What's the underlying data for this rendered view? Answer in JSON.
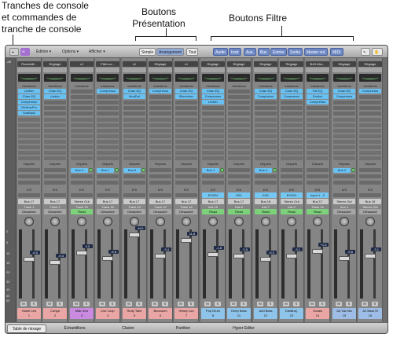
{
  "annotations": {
    "strips": "Tranches de console\net commandes de\ntranche de console",
    "view_buttons": "Boutons\nPrésentation",
    "filter_buttons": "Boutons Filtre"
  },
  "toolbar": {
    "edit": "Édition",
    "options": "Options",
    "view": "Afficher",
    "view_buttons": [
      "Simple",
      "Arrangement",
      "Tout"
    ],
    "view_selected": "Arrangement",
    "filter_buttons": [
      "Audio",
      "Instr",
      "Aux.",
      "Bus",
      "Entrée",
      "Sortie",
      "Master vol.",
      "MIDI"
    ]
  },
  "labels": {
    "settings": "Réglage",
    "inserts": "Insertions",
    "sends": "Départs",
    "io": "E/S",
    "off": "Désactivé",
    "read": "Read",
    "sidechain": "Side Chain"
  },
  "scale_marks": [
    "-dB",
    "0",
    "6",
    "10",
    "15",
    "20",
    "30",
    "40",
    "50",
    "60"
  ],
  "strips": [
    {
      "setting": "Rockabill...",
      "inserts": [
        "Limiter",
        "Chan EQ",
        "Compresso",
        "GtrAmpPro",
        "SubBass"
      ],
      "send": "",
      "input": "",
      "output": "Bus 17",
      "group": "Track 1",
      "auto": "Désactivé",
      "db": "-6.0",
      "name": "Noise Lea",
      "num": "1",
      "color": "#e9a6a4"
    },
    {
      "setting": "Réglage",
      "inserts": [
        "Chan EQ",
        "Limiter"
      ],
      "send": "",
      "input": "",
      "output": "Bus 17",
      "group": "Track 2",
      "auto": "Désactivé",
      "db": "-9.4",
      "name": "Conga",
      "num": "2",
      "color": "#e9a6a4"
    },
    {
      "setting": "v1",
      "inserts": [],
      "send": "Bus 4",
      "input": "",
      "output": "Stereo Out",
      "group": "Track 15",
      "auto": "Read",
      "db": "0.0",
      "name": "Main Dru",
      "num": "3",
      "color": "#c98ae0"
    },
    {
      "setting": "Filter.co...",
      "inserts": [
        "Compresso"
      ],
      "send": "Bus 1",
      "input": "",
      "output": "Bus 17",
      "group": "Track 18",
      "auto": "Désactivé",
      "db": "-5.6",
      "name": "Live Loop",
      "num": "4",
      "color": "#e9a6a4"
    },
    {
      "setting": "v1",
      "inserts": [
        "Chan EQ",
        "ModDel"
      ],
      "send": "Bus 5",
      "input": "",
      "output": "Bus 17",
      "group": "Track 23",
      "auto": "Désactivé",
      "db": "44.0",
      "name": "Rudy Tabe",
      "num": "5",
      "color": "#e9a6a4"
    },
    {
      "setting": "Réglage",
      "inserts": [
        "Compresso"
      ],
      "send": "",
      "input": "",
      "output": "Bus 17",
      "group": "Track 22",
      "auto": "Désactivé",
      "db": "-3.4",
      "name": "Booooom",
      "num": "6",
      "color": "#e9a6a4"
    },
    {
      "setting": "v1",
      "inserts": [
        "Chan EQ",
        "Bitcrusher"
      ],
      "send": "",
      "input": "",
      "output": "Bus 17",
      "group": "Track 16",
      "auto": "Désactivé",
      "db": "11.8",
      "name": "Heavy Loo",
      "num": "7",
      "color": "#e9a6a4"
    },
    {
      "setting": "Réglage",
      "inserts": [
        "Chan EQ",
        "Compresso",
        "Limiter"
      ],
      "send": "Bus 1",
      "input": "EXS24",
      "output": "Bus 17",
      "group": "Inst 15",
      "auto": "Read",
      "db": "-1.8",
      "name": "Pop Drum",
      "num": "8",
      "color": "#8fc4ea"
    },
    {
      "setting": "Réglage",
      "inserts": [],
      "send": "",
      "input": "ES1",
      "output": "Bus 17",
      "group": "Inst 6",
      "auto": "Read",
      "db": "-3.5",
      "name": "Deep Bass",
      "num": "11",
      "color": "#8fc4ea"
    },
    {
      "setting": "Réglage",
      "inserts": [
        "Chan EQ",
        "Compresso"
      ],
      "send": "Bus 4",
      "input": "ES2",
      "output": "Bus 18",
      "group": "Inst 7",
      "auto": "Read",
      "db": "-6.0",
      "name": "Add Bass",
      "num": "12",
      "color": "#8fc4ea"
    },
    {
      "setting": "Réglage",
      "inserts": [
        "Chan EQ",
        "Compresso"
      ],
      "send": "",
      "input": "EXS24",
      "output": "Stereo Out",
      "group": "Inst 2",
      "auto": "Read",
      "db": "-3.1",
      "name": "Distillus(.",
      "num": "13",
      "color": "#8fc4ea"
    },
    {
      "setting": "B4S-Mor...",
      "inserts": [
        "Fat EQ",
        "Exciter",
        "Compresso"
      ],
      "send": "",
      "input": "Input 1 - 2",
      "output": "Bus 17",
      "group": "Track 15",
      "auto": "Read",
      "db": "+1.5",
      "name": "Vocals",
      "num": "14",
      "color": "#e9a6a4"
    },
    {
      "setting": "Réglage",
      "inserts": [
        "Chan EQ",
        "Compresso"
      ],
      "send": "Bus 2",
      "input": "",
      "output": "Stereo Out",
      "group": "Aux 4",
      "auto": "Désactivé",
      "db": "-5.6",
      "name": "A4 Vac Ma",
      "num": "15",
      "color": "#9dbde6"
    },
    {
      "setting": "Réglage",
      "inserts": [
        "Compresso"
      ],
      "send": "",
      "input": "",
      "output": "Bus 18",
      "group": "Stereo Out",
      "auto": "Désactivé",
      "db": "-3.1",
      "name": "A2 Bass M",
      "num": "16",
      "color": "#9dbde6"
    }
  ],
  "bottom_tabs": [
    "Table de mixage",
    "Échantillons",
    "Clavier",
    "Partition",
    "Hyper Editor"
  ],
  "bottom_selected": "Table de mixage"
}
